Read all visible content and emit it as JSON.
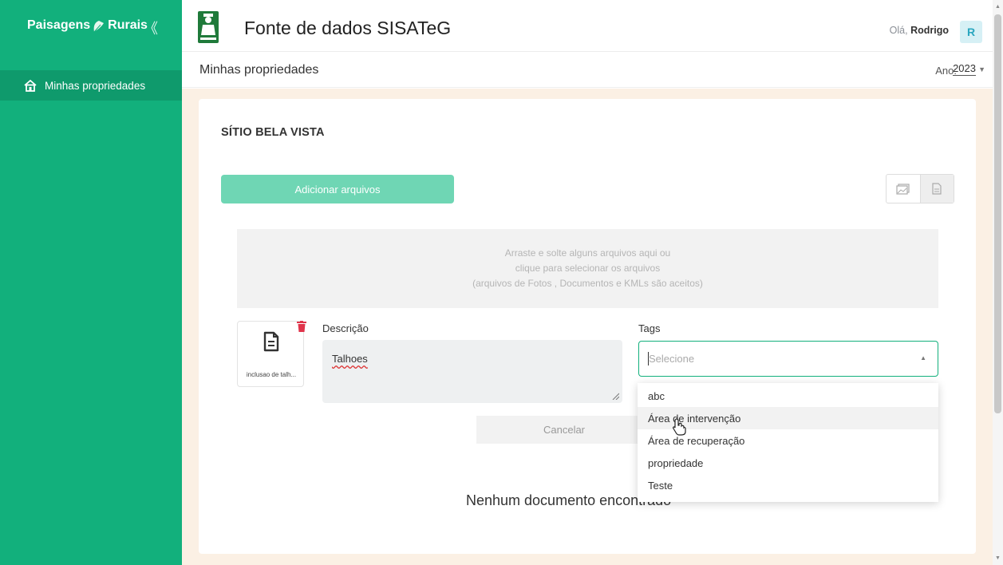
{
  "sidebar": {
    "brand_left": "Paisagens",
    "brand_right": "Rurais",
    "collapse_icon": "double-chevron-left-icon",
    "items": [
      {
        "label": "Minhas propriedades",
        "icon": "home-icon"
      }
    ]
  },
  "header": {
    "title": "Fonte de dados SISATeG",
    "greeting_prefix": "Olá,",
    "user_name": "Rodrigo",
    "avatar_initial": "R"
  },
  "breadcrumb": {
    "title": "Minhas propriedades",
    "year_label": "Ano:",
    "year_value": "2023"
  },
  "property": {
    "name": "SÍTIO BELA VISTA",
    "add_files_label": "Adicionar arquivos",
    "dropzone_lines": [
      "Arraste e solte alguns arquivos aqui ou",
      "clique para selecionar os arquivos",
      "(arquivos de Fotos , Documentos e KMLs são aceitos)"
    ]
  },
  "upload": {
    "file_name": "inclusao de talh...",
    "description_label": "Descrição",
    "description_value": "Talhoes",
    "tags_label": "Tags",
    "tags_placeholder": "Selecione",
    "cancel_label": "Cancelar",
    "tag_options": [
      "abc",
      "Área de intervenção",
      "Área de recuperação",
      "propriedade",
      "Teste"
    ],
    "hovered_option_index": 1
  },
  "empty_message": "Nenhum documento encontrado",
  "colors": {
    "brand_green": "#12b07c",
    "button_green": "#6fd6b4",
    "content_bg": "#fbf0e4",
    "delete_red": "#e0344b"
  }
}
